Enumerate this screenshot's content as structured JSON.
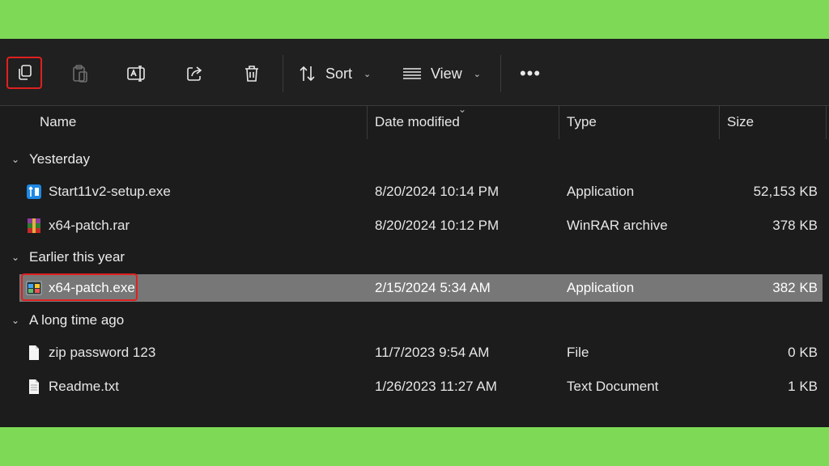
{
  "toolbar": {
    "copy_icon": "copy-icon",
    "paste_icon": "paste-icon",
    "rename_icon": "rename-icon",
    "share_icon": "share-icon",
    "delete_icon": "delete-icon",
    "sort_label": "Sort",
    "view_label": "View",
    "more_label": "•••"
  },
  "columns": {
    "name": "Name",
    "date": "Date modified",
    "type": "Type",
    "size": "Size"
  },
  "groups": [
    {
      "label": "Yesterday",
      "files": [
        {
          "name": "Start11v2-setup.exe",
          "date": "8/20/2024 10:14 PM",
          "type": "Application",
          "size": "52,153 KB",
          "icon": "installer-icon"
        },
        {
          "name": "x64-patch.rar",
          "date": "8/20/2024 10:12 PM",
          "type": "WinRAR archive",
          "size": "378 KB",
          "icon": "winrar-icon"
        }
      ]
    },
    {
      "label": "Earlier this year",
      "files": [
        {
          "name": "x64-patch.exe",
          "date": "2/15/2024 5:34 AM",
          "type": "Application",
          "size": "382 KB",
          "icon": "exe-icon",
          "selected": true
        }
      ]
    },
    {
      "label": "A long time ago",
      "files": [
        {
          "name": "zip password 123",
          "date": "11/7/2023 9:54 AM",
          "type": "File",
          "size": "0 KB",
          "icon": "file-icon"
        },
        {
          "name": "Readme.txt",
          "date": "1/26/2023 11:27 AM",
          "type": "Text Document",
          "size": "1 KB",
          "icon": "text-file-icon"
        }
      ]
    }
  ],
  "colors": {
    "background": "#7ed957",
    "window": "#1c1c1c",
    "selection": "#777777",
    "highlight": "#e02020"
  }
}
